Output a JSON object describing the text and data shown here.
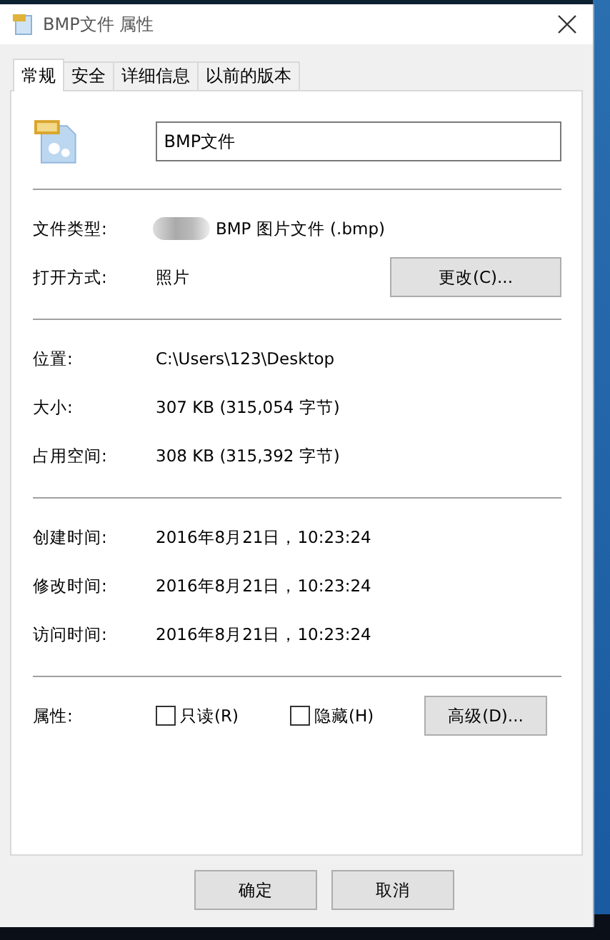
{
  "window": {
    "title": "BMP文件 属性"
  },
  "tabs": [
    {
      "label": "常规",
      "selected": true
    },
    {
      "label": "安全",
      "selected": false
    },
    {
      "label": "详细信息",
      "selected": false
    },
    {
      "label": "以前的版本",
      "selected": false
    }
  ],
  "file_name": {
    "value": "BMP文件"
  },
  "type_rows": [
    {
      "label": "文件类型:",
      "value": "BMP 图片文件 (.bmp)",
      "kind": "type"
    },
    {
      "label": "打开方式:",
      "value": "照片",
      "kind": "open",
      "button": "更改(C)..."
    }
  ],
  "location_rows": [
    {
      "label": "位置:",
      "value": "C:\\Users\\123\\Desktop"
    },
    {
      "label": "大小:",
      "value": "307 KB (315,054 字节)"
    },
    {
      "label": "占用空间:",
      "value": "308 KB (315,392 字节)"
    }
  ],
  "time_rows": [
    {
      "label": "创建时间:",
      "value": "2016年8月21日，10:23:24"
    },
    {
      "label": "修改时间:",
      "value": "2016年8月21日，10:23:24"
    },
    {
      "label": "访问时间:",
      "value": "2016年8月21日，10:23:24"
    }
  ],
  "attributes": {
    "label": "属性:",
    "checkboxes": [
      {
        "label": "只读(R)",
        "checked": false
      },
      {
        "label": "隐藏(H)",
        "checked": false
      }
    ],
    "button": "高级(D)..."
  },
  "buttons": [
    "确定",
    "取消"
  ]
}
